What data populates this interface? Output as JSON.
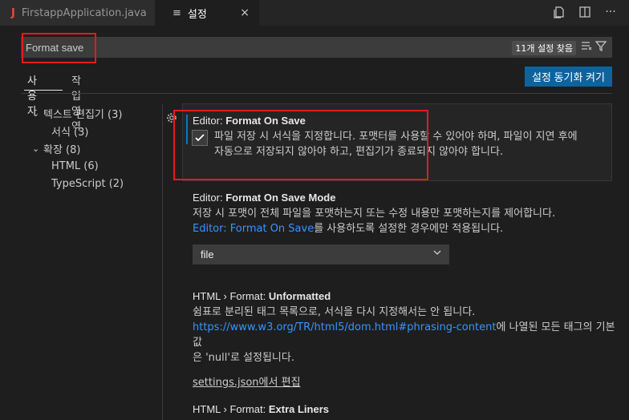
{
  "tabs": [
    {
      "icon": "J",
      "label": "FirstappApplication.java"
    },
    {
      "icon": "≡",
      "label": "설정",
      "close": "×"
    }
  ],
  "search": {
    "value": "Format save",
    "result_count": "11개 설정 찾음"
  },
  "scopes": {
    "user": "사용자",
    "workspace": "작업 영역"
  },
  "sync_button": "설정 동기화 켜기",
  "toc": [
    {
      "label": "텍스트 편집기 (3)",
      "expanded": true,
      "level": 1
    },
    {
      "label": "서식 (3)",
      "level": 2
    },
    {
      "label": "확장 (8)",
      "expanded": true,
      "level": 1
    },
    {
      "label": "HTML (6)",
      "level": 2
    },
    {
      "label": "TypeScript (2)",
      "level": 2
    }
  ],
  "settings": {
    "format_on_save": {
      "category": "Editor: ",
      "name": "Format On Save",
      "checked": true,
      "desc_line1": "파일 저장 시 서식을 지정합니다. 포맷터를 사용할 수 있어야 하며, 파일이 지연 후에",
      "desc_line2": "자동으로 저장되지 않아야 하고, 편집기가 종료되지 않아야 합니다."
    },
    "format_on_save_mode": {
      "category": "Editor: ",
      "name": "Format On Save Mode",
      "desc_line1": "저장 시 포맷이 전체 파일을 포맷하는지 또는 수정 내용만 포맷하는지를 제어합니다.",
      "desc_link": "Editor: Format On Save",
      "desc_line2_rest": "를 사용하도록 설정한 경우에만 적용됩니다.",
      "value": "file"
    },
    "unformatted": {
      "category": "HTML › Format: ",
      "name": "Unformatted",
      "desc_line1": "쉼표로 분리된 태그 목록으로, 서식을 다시 지정해서는 안 됩니다.",
      "desc_link": "https://www.w3.org/TR/html5/dom.html#phrasing-content",
      "desc_line2_rest": "에 나열된 모든 태그의 기본값",
      "desc_line3": "은 'null'로 설정됩니다.",
      "edit_link": "settings.json에서 편집"
    },
    "extra_liners": {
      "category": "HTML › Format: ",
      "name": "Extra Liners"
    }
  }
}
